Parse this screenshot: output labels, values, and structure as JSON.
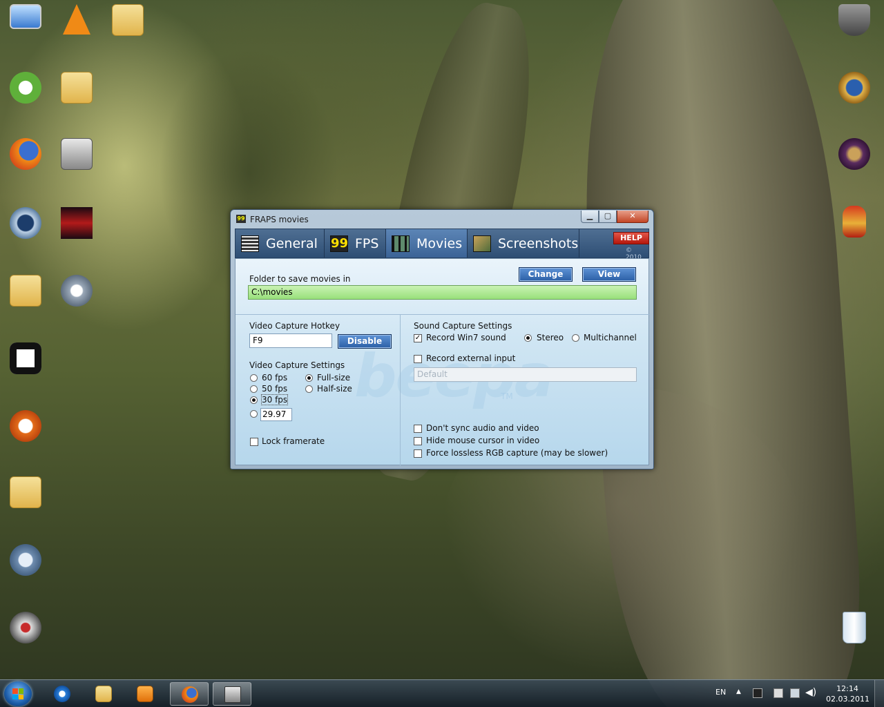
{
  "window": {
    "title": "FRAPS movies",
    "tabs": [
      {
        "label": "General",
        "icon": "grid-icon"
      },
      {
        "label": "FPS",
        "icon_text": "99"
      },
      {
        "label": "Movies",
        "icon": "film-icon"
      },
      {
        "label": "Screenshots",
        "icon": "picture-icon"
      }
    ],
    "help_label": "HELP",
    "copyright": "© 2010",
    "watermark": "beepa",
    "trademark": "TM"
  },
  "movies": {
    "folder_label": "Folder to save movies in",
    "change_label": "Change",
    "view_label": "View",
    "folder_value": "C:\\movies",
    "hotkey_label": "Video Capture Hotkey",
    "hotkey_value": "F9",
    "disable_label": "Disable",
    "video_settings_label": "Video Capture Settings",
    "fps_options": [
      "60 fps",
      "50 fps",
      "30 fps",
      "29.97"
    ],
    "fps_selected": "30 fps",
    "size_options": [
      "Full-size",
      "Half-size"
    ],
    "size_selected": "Full-size",
    "lock_framerate_label": "Lock framerate",
    "lock_framerate_checked": false,
    "sound_settings_label": "Sound Capture Settings",
    "record_win7_label": "Record Win7 sound",
    "record_win7_checked": true,
    "channel_options": [
      "Stereo",
      "Multichannel"
    ],
    "channel_selected": "Stereo",
    "record_external_label": "Record external input",
    "record_external_checked": false,
    "external_device_value": "Default",
    "no_sync_label": "Don't sync audio and video",
    "hide_cursor_label": "Hide mouse cursor in video",
    "lossless_label": "Force lossless RGB capture (may be slower)"
  },
  "taskbar": {
    "language": "EN",
    "time": "12:14",
    "date": "02.03.2011",
    "pinned": [
      "internet-explorer-icon",
      "explorer-folder-icon",
      "media-player-icon",
      "firefox-icon",
      "fraps-icon"
    ]
  },
  "colors": {
    "tab_bar": "#2e4e74",
    "active_tab": "#4a75a8",
    "content_bg": "#cfe5f3",
    "folder_field": "#98e07b",
    "button_blue": "#2b5fa6",
    "help_red": "#b5170c"
  }
}
